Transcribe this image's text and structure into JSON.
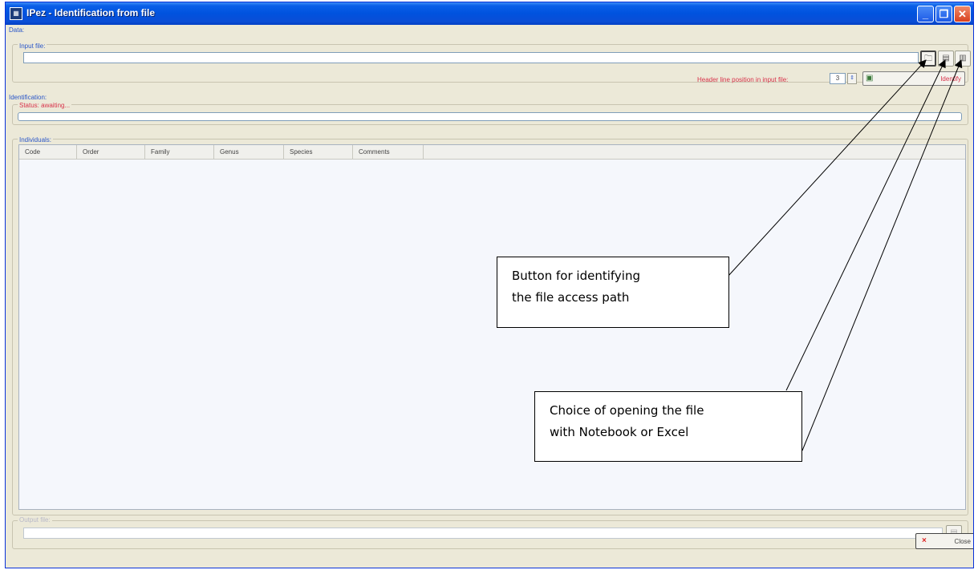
{
  "window": {
    "title": "IPez - Identification from file"
  },
  "data_section": {
    "label": "Data:",
    "input_file_label": "Input file:",
    "input_file_value": ""
  },
  "header_line": {
    "label": "Header line position in input file:",
    "value": "3"
  },
  "identify_button": {
    "label": "Identify"
  },
  "identification_section": {
    "label": "Identification:",
    "status": "Status: awaiting..."
  },
  "individuals_section": {
    "label": "Individuals:",
    "columns": [
      "Code",
      "Order",
      "Family",
      "Genus",
      "Species",
      "Comments"
    ]
  },
  "output_section": {
    "label": "Output file:",
    "value": ""
  },
  "close_button": {
    "label": "Close"
  },
  "callouts": {
    "browse": [
      "Button for identifying",
      "the file access path"
    ],
    "open_with": [
      "Choice of opening the file",
      "with Notebook or Excel"
    ]
  },
  "colors": {
    "titlebar": "#0052de",
    "label_blue": "#2a56c8",
    "status_red": "#d8324a",
    "window_bg": "#ece9d8"
  }
}
